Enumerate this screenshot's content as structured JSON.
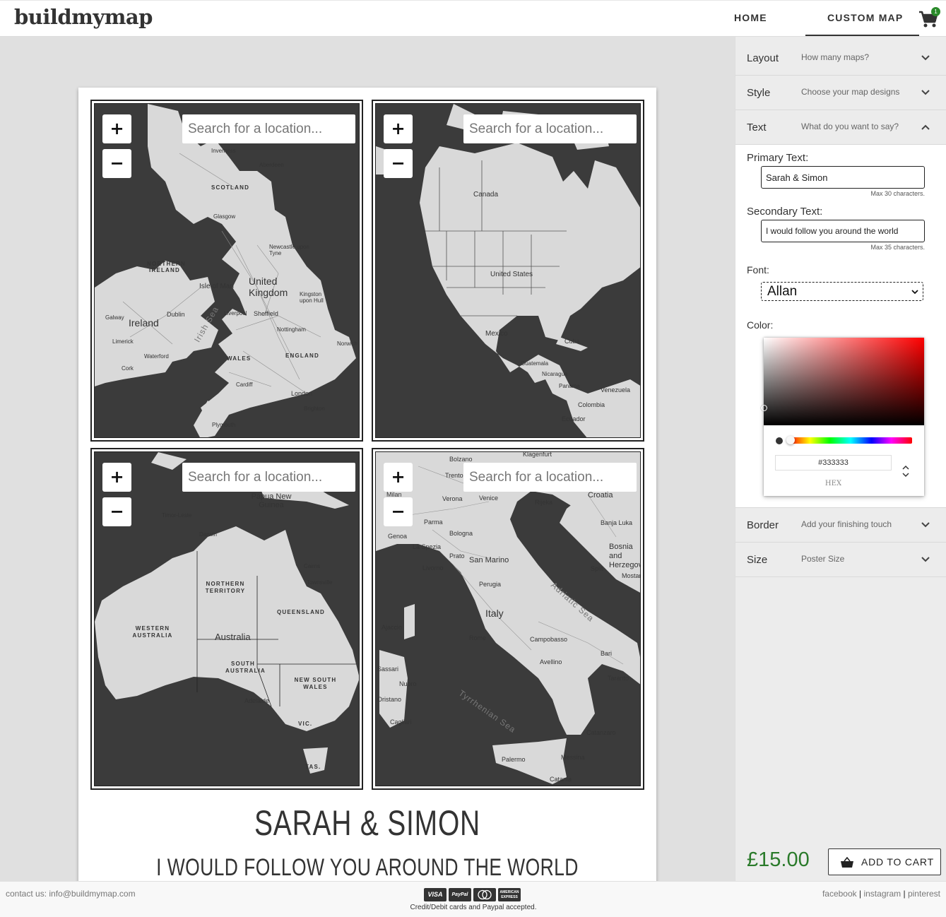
{
  "header": {
    "logo": "buildmymap",
    "nav": {
      "home": "HOME",
      "custom_map": "CUSTOM MAP"
    },
    "cart_count": "1"
  },
  "maps": [
    {
      "search_placeholder": "Search for a location...",
      "zoom_in": "+",
      "zoom_out": "−",
      "labels": [
        "Inverness",
        "Aberdeen",
        "SCOTLAND",
        "Glasgow",
        "NORTHERN IRELAND",
        "Newcastle upon Tyne",
        "Isle of Man",
        "United Kingdom",
        "Kingston upon Hull",
        "Irish Sea",
        "Ireland",
        "Liverpool",
        "Sheffield",
        "Dublin",
        "Galway",
        "Limerick",
        "Nottingham",
        "Waterford",
        "Cork",
        "WALES",
        "ENGLAND",
        "Norwich",
        "Cardiff",
        "London",
        "Brighton",
        "Plymouth"
      ]
    },
    {
      "search_placeholder": "Search for a location...",
      "zoom_in": "+",
      "zoom_out": "−",
      "labels": [
        "Canada",
        "United States",
        "Mexico",
        "Cuba",
        "Guatemala",
        "Nicaragua",
        "Panama",
        "Venezuela",
        "Colombia",
        "Ecuador"
      ]
    },
    {
      "search_placeholder": "Search for a location...",
      "zoom_in": "+",
      "zoom_out": "−",
      "labels": [
        "Papua New Guinea",
        "Timor-Leste",
        "Darwin",
        "Cairns",
        "Townsville",
        "NORTHERN TERRITORY",
        "QUEENSLAND",
        "WESTERN AUSTRALIA",
        "Australia",
        "SOUTH AUSTRALIA",
        "NEW SOUTH WALES",
        "Adelaide",
        "VIC.",
        "TAS."
      ]
    },
    {
      "search_placeholder": "Search for a location...",
      "zoom_in": "+",
      "zoom_out": "−",
      "labels": [
        "Bolzano",
        "Klagenfurt",
        "Trento",
        "Verona",
        "Venice",
        "Croatia",
        "Milan",
        "Rijeka",
        "Parma",
        "Bologna",
        "Banja Luka",
        "Genoa",
        "La Spezia",
        "Prato",
        "San Marino",
        "Bosnia and Herzegovina",
        "Livorno",
        "Perugia",
        "Split",
        "Mostar",
        "Adriatic Sea",
        "Italy",
        "Ajaccio",
        "Rome",
        "Campobasso",
        "Bari",
        "Avellino",
        "Taranto",
        "Sassari",
        "Nuoro",
        "Oristano",
        "Tyrrhenian Sea",
        "Cagliari",
        "Catanzaro",
        "Palermo",
        "Messina",
        "Catania"
      ]
    }
  ],
  "poster": {
    "primary_text": "SARAH & SIMON",
    "secondary_text": "I WOULD FOLLOW YOU AROUND THE WORLD"
  },
  "sidebar": {
    "sections": [
      {
        "title": "Layout",
        "subtitle": "How many maps?"
      },
      {
        "title": "Style",
        "subtitle": "Choose your map designs"
      },
      {
        "title": "Text",
        "subtitle": "What do you want to say?"
      },
      {
        "title": "Border",
        "subtitle": "Add your finishing touch"
      },
      {
        "title": "Size",
        "subtitle": "Poster Size"
      }
    ],
    "text_panel": {
      "primary_label": "Primary Text:",
      "primary_value": "Sarah & Simon",
      "primary_max": "Max 30 characters.",
      "secondary_label": "Secondary Text:",
      "secondary_value": "I would follow you around the world",
      "secondary_max": "Max 35 characters.",
      "font_label": "Font:",
      "font_value": "Allan",
      "color_label": "Color:",
      "hex_value": "#333333",
      "hex_mode": "HEX"
    },
    "price": "£15.00",
    "add_to_cart": "ADD TO CART"
  },
  "footer": {
    "contact": "contact us: info@buildmymap.com",
    "payment_text": "Credit/Debit cards and Paypal accepted.",
    "payment_icons": [
      "VISA",
      "PayPal",
      "MasterCard",
      "AMERICAN EXPRESS"
    ],
    "social": [
      "facebook",
      "instagram",
      "pinterest"
    ],
    "separator": "|"
  },
  "colors": {
    "map_water": "#3b3b3b",
    "map_land": "#d9d9d9",
    "price_green": "#2a7a2a",
    "selected_color": "#333333"
  }
}
